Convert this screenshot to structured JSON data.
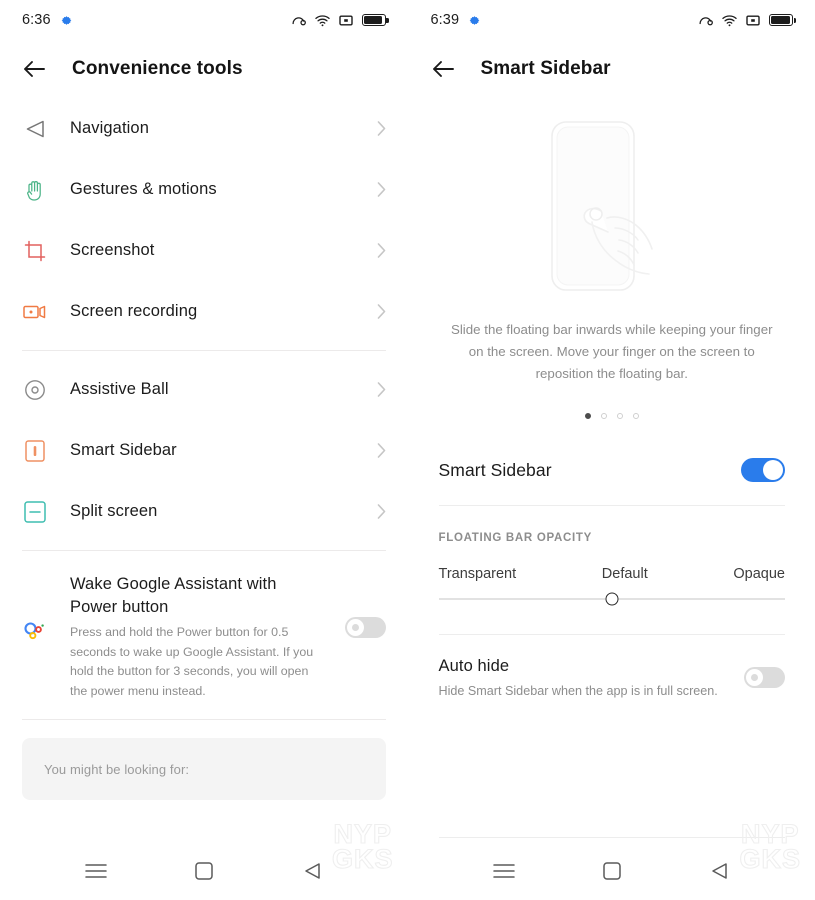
{
  "left_screen": {
    "statusbar": {
      "time": "6:36",
      "icons": [
        "gear-icon",
        "headphone-icon",
        "wifi-icon",
        "vibrate-icon",
        "battery-icon"
      ]
    },
    "appbar": {
      "back_label": "back-arrow",
      "title": "Convenience tools"
    },
    "group1": [
      {
        "label": "Navigation",
        "icon": "navigation-triangle-icon",
        "color": "#6f6f6f"
      },
      {
        "label": "Gestures & motions",
        "icon": "hand-icon",
        "color": "#4cb488"
      },
      {
        "label": "Screenshot",
        "icon": "crop-icon",
        "color": "#e2605f"
      },
      {
        "label": "Screen recording",
        "icon": "video-camera-icon",
        "color": "#f07a43"
      }
    ],
    "group2": [
      {
        "label": "Assistive Ball",
        "icon": "assistive-ball-icon",
        "color": "#8a8a8a"
      },
      {
        "label": "Smart Sidebar",
        "icon": "sidebar-icon",
        "color": "#ef9163"
      },
      {
        "label": "Split screen",
        "icon": "split-screen-icon",
        "color": "#3fbdb0"
      }
    ],
    "assistant": {
      "title": "Wake Google Assistant with Power button",
      "description": "Press and hold the Power button for 0.5 seconds to wake up Google Assistant. If you hold the button for 3 seconds, you will open the power menu instead.",
      "toggle_state": "off"
    },
    "suggestion_card": {
      "text": "You might be looking for:"
    },
    "navbar": [
      "menu-icon",
      "home-icon",
      "back-icon"
    ],
    "watermark_line1": "NYP",
    "watermark_line2": "GKS"
  },
  "right_screen": {
    "statusbar": {
      "time": "6:39",
      "icons": [
        "gear-icon",
        "headphone-icon",
        "wifi-icon",
        "vibrate-icon",
        "battery-icon"
      ]
    },
    "appbar": {
      "back_label": "back-arrow",
      "title": "Smart Sidebar"
    },
    "illustration": "phone-with-finger-swipe-illustration",
    "description": "Slide the floating bar inwards while keeping your finger on the screen. Move your finger on the screen to reposition the floating bar.",
    "pager": {
      "count": 4,
      "active_index": 0
    },
    "main_toggle": {
      "label": "Smart Sidebar",
      "state": "on",
      "color": "#2a7ceb"
    },
    "opacity_section": {
      "caption": "FLOATING BAR OPACITY",
      "labels": [
        "Transparent",
        "Default",
        "Opaque"
      ],
      "value_position": "Default"
    },
    "auto_hide": {
      "title": "Auto hide",
      "description": "Hide Smart Sidebar when the app is in full screen.",
      "toggle_state": "off"
    },
    "navbar": [
      "menu-icon",
      "home-icon",
      "back-icon"
    ],
    "watermark_line1": "NYP",
    "watermark_line2": "GKS"
  }
}
